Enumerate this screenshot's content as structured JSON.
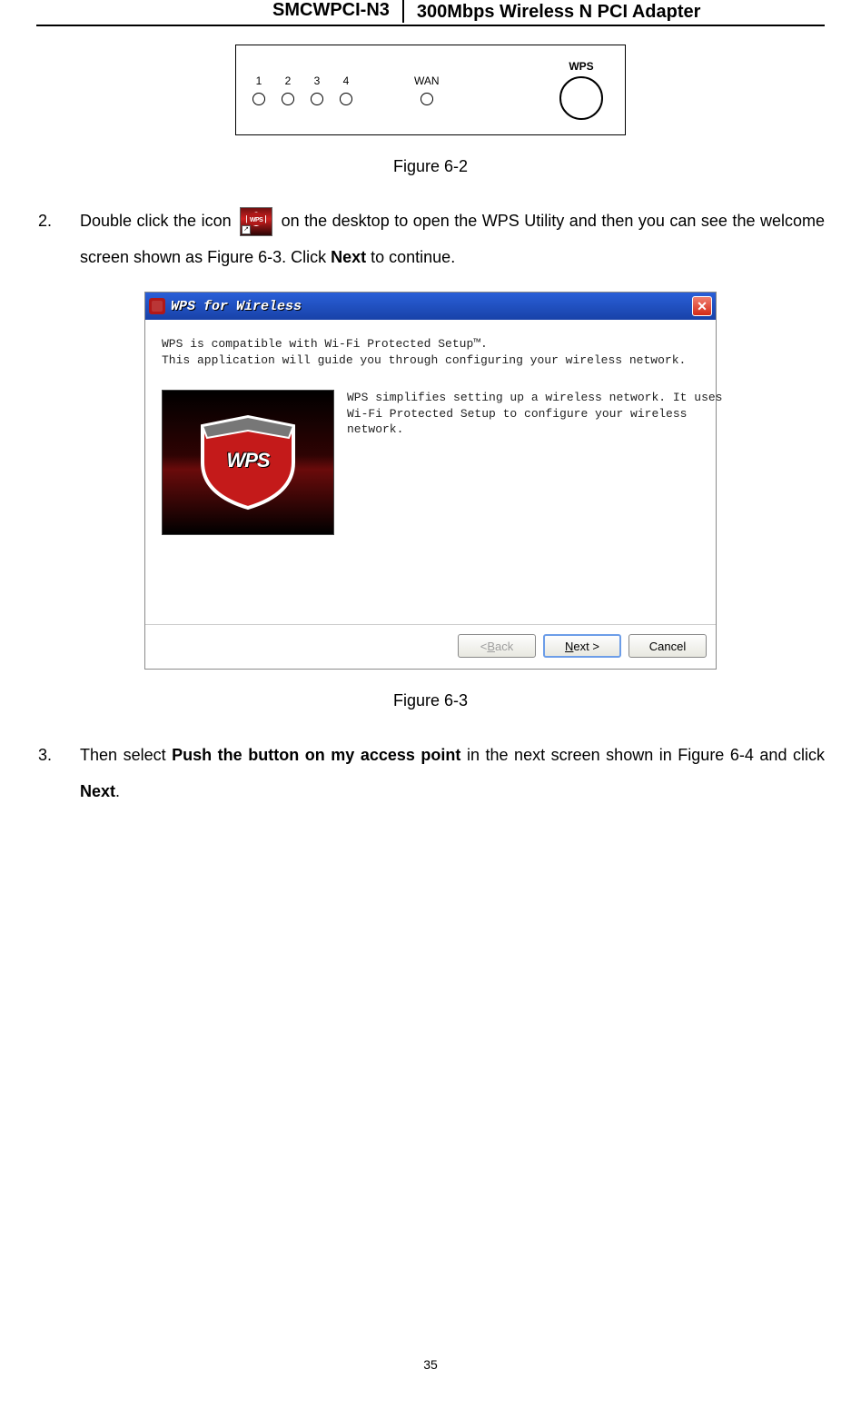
{
  "header": {
    "model": "SMCWPCI-N3",
    "product": "300Mbps Wireless N PCI Adapter"
  },
  "router_panel": {
    "ports": [
      "1",
      "2",
      "3",
      "4"
    ],
    "wan_label": "WAN",
    "wps_label": "WPS"
  },
  "captions": {
    "fig_6_2": "Figure 6-2",
    "fig_6_3": "Figure 6-3"
  },
  "steps": {
    "two": {
      "num": "2.",
      "before_icon": "Double click the icon ",
      "after_icon": " on the desktop to open the WPS Utility and then you can see the welcome screen shown as Figure 6-3. Click ",
      "bold1": "Next",
      "tail": " to continue."
    },
    "three": {
      "num": "3.",
      "before_bold1": "Then select ",
      "bold1": "Push the button on my access point",
      "mid": " in the next screen shown in Figure 6-4 and click ",
      "bold2": "Next",
      "tail": "."
    }
  },
  "dialog": {
    "title": "WPS for Wireless",
    "close_glyph": "✕",
    "intro_line1": "WPS is compatible with Wi-Fi Protected Setup™.",
    "intro_line2": "This application will guide you through configuring your wireless network.",
    "body_line1": "WPS simplifies setting up a wireless network. It uses",
    "body_line2": "Wi-Fi Protected Setup to configure your wireless",
    "body_line3": "network.",
    "shield_text": "WPS",
    "buttons": {
      "back_pre": "< ",
      "back_u": "B",
      "back_post": "ack",
      "next_u": "N",
      "next_post": "ext >",
      "cancel": "Cancel"
    }
  },
  "page_number": "35"
}
